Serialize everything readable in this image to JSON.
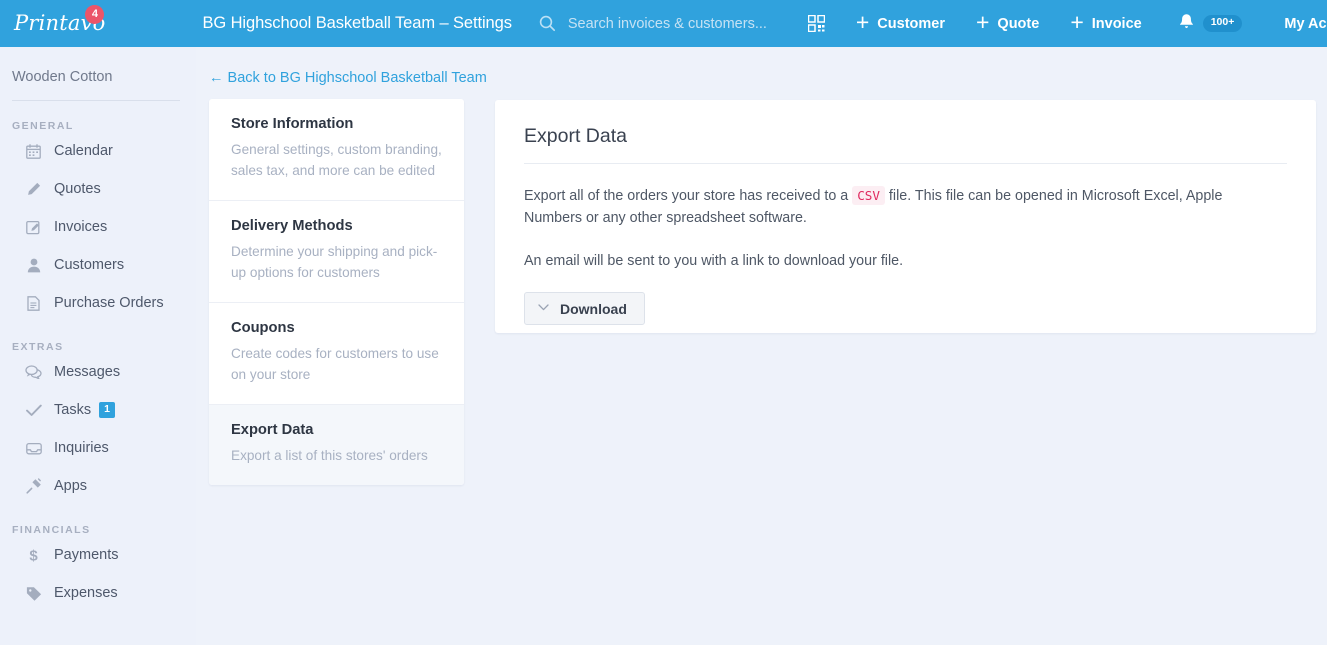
{
  "header": {
    "logo_text": "Printavo",
    "logo_badge": "4",
    "logo_badge_color": "#eb5569",
    "brand_color": "#30a2dd",
    "context_title": "BG Highschool Basketball Team – Settings",
    "search": {
      "placeholder": "Search invoices & customers...",
      "value": "",
      "icon": "search-icon"
    },
    "qr_icon": "qr-code-icon",
    "actions": [
      {
        "label": "Customer",
        "icon": "plus-icon"
      },
      {
        "label": "Quote",
        "icon": "plus-icon"
      },
      {
        "label": "Invoice",
        "icon": "plus-icon"
      }
    ],
    "notifications": {
      "icon": "bell-icon",
      "count": "100+"
    },
    "account_label": "My Account"
  },
  "sidebar": {
    "store_name": "Wooden Cotton",
    "sections": [
      {
        "label": "GENERAL",
        "items": [
          {
            "label": "Calendar",
            "icon": "calendar-icon",
            "badge": null
          },
          {
            "label": "Quotes",
            "icon": "pencil-icon",
            "badge": null
          },
          {
            "label": "Invoices",
            "icon": "invoice-icon",
            "badge": null
          },
          {
            "label": "Customers",
            "icon": "person-icon",
            "badge": null
          },
          {
            "label": "Purchase Orders",
            "icon": "document-icon",
            "badge": null
          }
        ]
      },
      {
        "label": "EXTRAS",
        "items": [
          {
            "label": "Messages",
            "icon": "chat-icon",
            "badge": null
          },
          {
            "label": "Tasks",
            "icon": "check-icon",
            "badge": "1"
          },
          {
            "label": "Inquiries",
            "icon": "inbox-icon",
            "badge": null
          },
          {
            "label": "Apps",
            "icon": "plug-icon",
            "badge": null
          }
        ]
      },
      {
        "label": "FINANCIALS",
        "items": [
          {
            "label": "Payments",
            "icon": "dollar-icon",
            "badge": null
          },
          {
            "label": "Expenses",
            "icon": "tag-icon",
            "badge": null
          }
        ]
      }
    ]
  },
  "content": {
    "back_link": "← Back to BG Highschool Basketball Team",
    "settings_menu": [
      {
        "title": "Store Information",
        "desc": "General settings, custom branding, sales tax, and more can be edited",
        "active": false
      },
      {
        "title": "Delivery Methods",
        "desc": "Determine your shipping and pick-up options for customers",
        "active": false
      },
      {
        "title": "Coupons",
        "desc": "Create codes for customers to use on your store",
        "active": false
      },
      {
        "title": "Export Data",
        "desc": "Export a list of this stores' orders",
        "active": true
      }
    ],
    "panel": {
      "title": "Export Data",
      "paragraph1_part1": "Export all of the orders your store has received to a ",
      "paragraph1_code": "CSV",
      "paragraph1_part2": " file. This file can be opened in Microsoft Excel, Apple Numbers or any other spreadsheet software.",
      "paragraph2": "An email will be sent to you with a link to download your file.",
      "download_label": "Download",
      "download_caret_icon": "chevron-down-icon"
    }
  }
}
